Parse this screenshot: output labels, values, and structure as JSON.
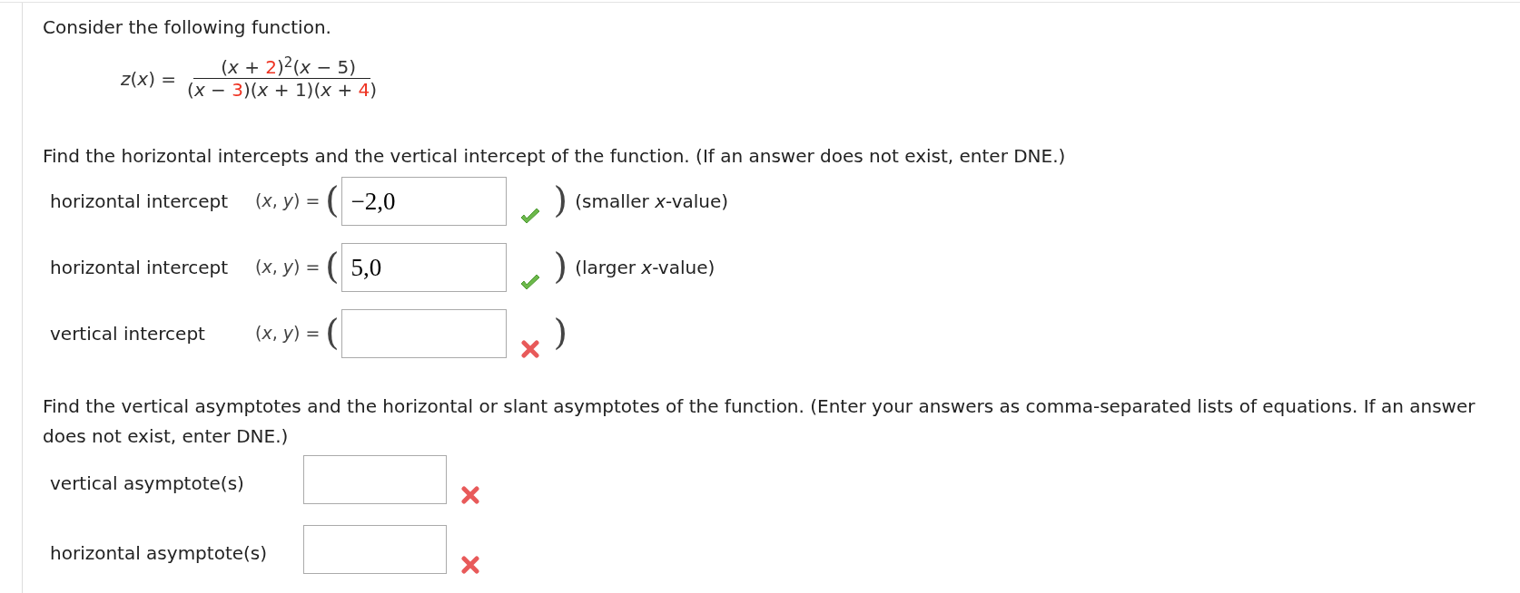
{
  "intro": "Consider the following function.",
  "formula": {
    "lhs": "*z*(*x*) =",
    "numerator": [
      {
        "kind": "plain",
        "text": "(*x* + "
      },
      {
        "kind": "highlight",
        "text": "2"
      },
      {
        "kind": "plain",
        "text": ")"
      },
      {
        "kind": "sup",
        "text": "2"
      },
      {
        "kind": "plain",
        "text": "(*x* − 5)"
      }
    ],
    "denominator": [
      {
        "kind": "plain",
        "text": "(*x* − "
      },
      {
        "kind": "highlight",
        "text": "3"
      },
      {
        "kind": "plain",
        "text": ")(*x* + 1)(*x* + "
      },
      {
        "kind": "highlight",
        "text": "4"
      },
      {
        "kind": "plain",
        "text": ")"
      }
    ]
  },
  "intercepts": {
    "prompt": "Find the horizontal intercepts and the vertical intercept of the function. (If an answer does not exist, enter DNE.)",
    "rows": [
      {
        "label": "horizontal intercept",
        "lhs": "(*x*, *y*) =",
        "open_paren": "(",
        "value": "−2,0",
        "close_paren": ")",
        "correct": true,
        "note": "(smaller *x*-value)"
      },
      {
        "label": "horizontal intercept",
        "lhs": "(*x*, *y*) =",
        "open_paren": "(",
        "value": "5,0",
        "close_paren": ")",
        "correct": true,
        "note": "(larger *x*-value)"
      },
      {
        "label": "vertical intercept",
        "lhs": "(*x*, *y*) =",
        "open_paren": "(",
        "close_paren": ")",
        "correct": false
      }
    ]
  },
  "asymptotes": {
    "prompt": "Find the vertical asymptotes and the horizontal or slant asymptotes of the function. (Enter your answers as comma-separated lists of equations. If an answer does not exist, enter DNE.)",
    "rows": [
      {
        "label": "vertical asymptote(s)",
        "correct": false
      },
      {
        "label": "horizontal asymptote(s)",
        "correct": false
      }
    ]
  }
}
